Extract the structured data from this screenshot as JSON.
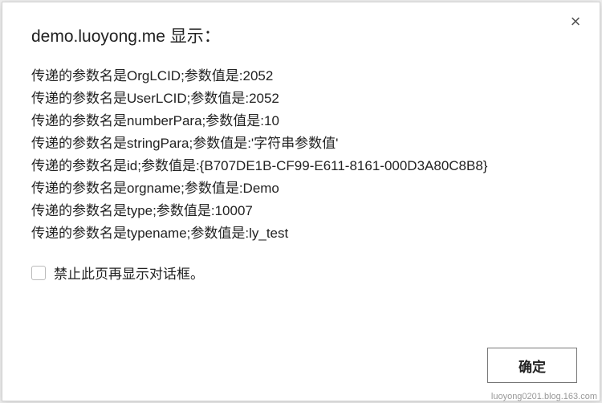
{
  "dialog": {
    "title": "demo.luoyong.me 显示：",
    "close_glyph": "×",
    "lines": [
      "传递的参数名是OrgLCID;参数值是:2052",
      "传递的参数名是UserLCID;参数值是:2052",
      "传递的参数名是numberPara;参数值是:10",
      "传递的参数名是stringPara;参数值是:'字符串参数值'",
      "传递的参数名是id;参数值是:{B707DE1B-CF99-E611-8161-000D3A80C8B8}",
      "传递的参数名是orgname;参数值是:Demo",
      "传递的参数名是type;参数值是:10007",
      "传递的参数名是typename;参数值是:ly_test"
    ],
    "suppress_label": "禁止此页再显示对话框。",
    "ok_label": "确定"
  },
  "watermark": "luoyong0201.blog.163.com"
}
